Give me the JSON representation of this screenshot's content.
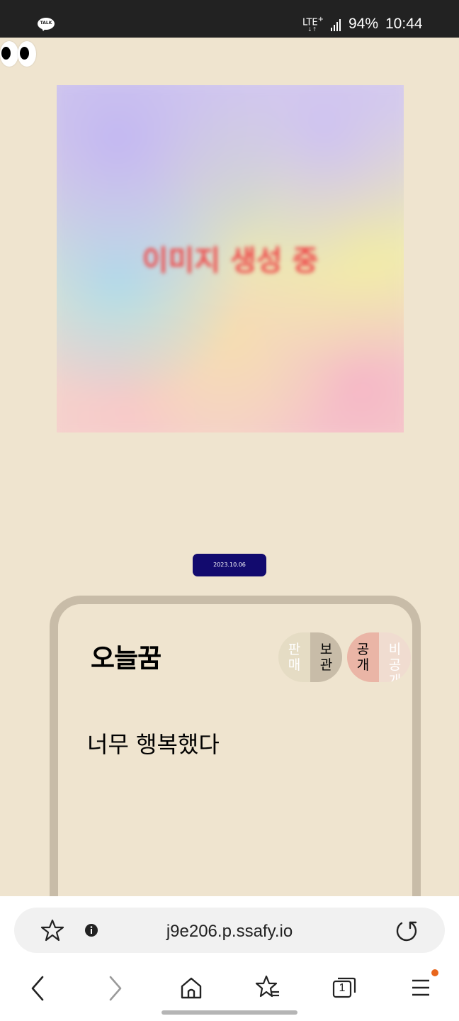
{
  "status_bar": {
    "app_icon_text": "TALK",
    "network": "LTE",
    "network_plus": "+",
    "battery": "94%",
    "time": "10:44"
  },
  "image": {
    "placeholder_text": "이미지 생성 중"
  },
  "dream": {
    "date": "2023.10.06",
    "title": "오늘꿈",
    "content": "너무 행복했다",
    "sale_toggle": {
      "off_label": "판매",
      "on_label": "보관"
    },
    "visibility_toggle": {
      "on_label": "공개",
      "off_label": "비공개"
    }
  },
  "browser": {
    "url": "j9e206.p.ssafy.io",
    "tab_count": "1"
  },
  "colors": {
    "background": "#efe4cf",
    "card_border": "#c8bca8",
    "date_badge": "#120a6e",
    "public_toggle": "#eab5a6",
    "notification": "#e8661c"
  }
}
